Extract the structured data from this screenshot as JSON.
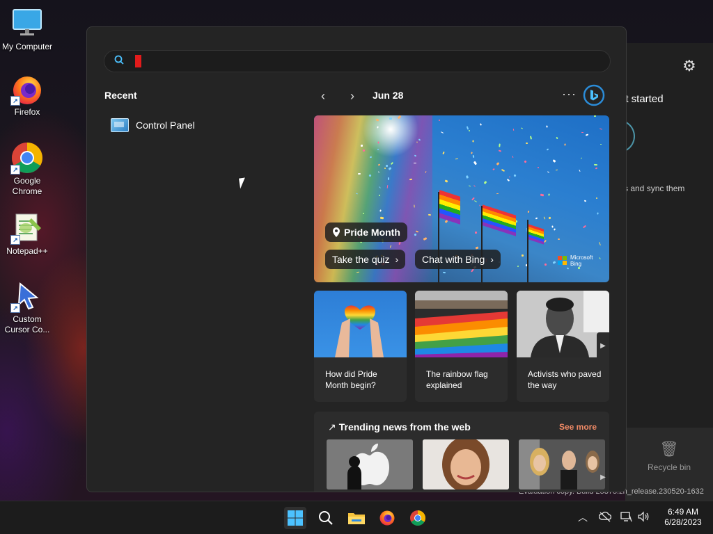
{
  "desktop": {
    "icons": [
      {
        "label": "My Computer",
        "icon": "monitor-icon"
      },
      {
        "label": "Firefox",
        "icon": "firefox-icon"
      },
      {
        "label": "Google Chrome",
        "icon": "chrome-icon"
      },
      {
        "label": "Notepad++",
        "icon": "notepadpp-icon"
      },
      {
        "label": "Custom Cursor Co...",
        "icon": "cursor-icon"
      }
    ],
    "recycle_bin_label": "Recycle bin",
    "evaluation_text": "Evaluation copy. Build 25375.zn_release.230520-1632"
  },
  "right_panel": {
    "get_started": "et started",
    "sync_text": "s and sync them"
  },
  "start_menu": {
    "search": {
      "value": "",
      "placeholder": ""
    },
    "recent": {
      "heading": "Recent",
      "items": [
        {
          "label": "Control Panel",
          "icon": "control-panel-icon"
        }
      ]
    },
    "widgets": {
      "date": "Jun 28",
      "more": "···",
      "hero": {
        "title": "Pride Month",
        "quiz_label": "Take the quiz",
        "chat_label": "Chat with Bing",
        "brand": "Microsoft Bing"
      },
      "cards": [
        {
          "caption": "How did Pride Month begin?"
        },
        {
          "caption": "The rainbow flag explained"
        },
        {
          "caption": "Activists who paved the way"
        }
      ],
      "trending": {
        "heading": "Trending news from the web",
        "see_more": "See more"
      }
    }
  },
  "taskbar": {
    "apps": [
      "start-icon",
      "search-icon",
      "file-explorer-icon",
      "firefox-icon",
      "chrome-icon"
    ],
    "time": "6:49 AM",
    "date": "6/28/2023"
  },
  "colors": {
    "accent": "#0078d4",
    "menu_bg": "#242424",
    "see_more": "#f08a66",
    "caret": "#e21b1b"
  }
}
